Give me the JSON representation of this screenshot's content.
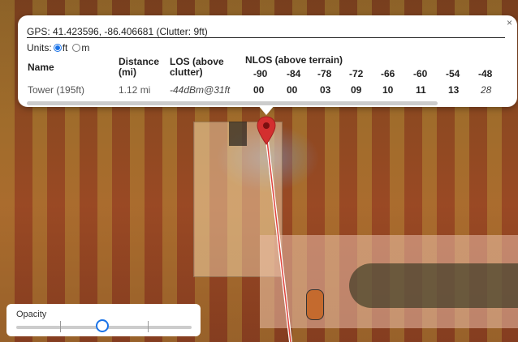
{
  "popup": {
    "gps_text": "GPS: 41.423596, -86.406681 (Clutter: 9ft)",
    "close_label": "×",
    "units": {
      "label": "Units:",
      "options": [
        "ft",
        "m"
      ],
      "selected": "ft"
    },
    "headers": {
      "name": "Name",
      "distance": [
        "Distance",
        "(mi)"
      ],
      "los": [
        "LOS (above",
        "clutter)"
      ],
      "nlos": "NLOS (above terrain)",
      "nlos_levels": [
        "-90",
        "-84",
        "-78",
        "-72",
        "-66",
        "-60",
        "-54",
        "-48"
      ]
    },
    "row": {
      "name": "Tower (195ft)",
      "distance": "1.12 mi",
      "los": "-44dBm@31ft",
      "nlos_values": [
        "00",
        "00",
        "03",
        "09",
        "10",
        "11",
        "13",
        "28"
      ]
    }
  },
  "opacity": {
    "label": "Opacity",
    "value": 0.5
  },
  "colors": {
    "accent": "#1a73e8",
    "marker": "#d32f2f"
  },
  "icons": {
    "marker": "map-pin-icon",
    "close": "close-icon"
  }
}
